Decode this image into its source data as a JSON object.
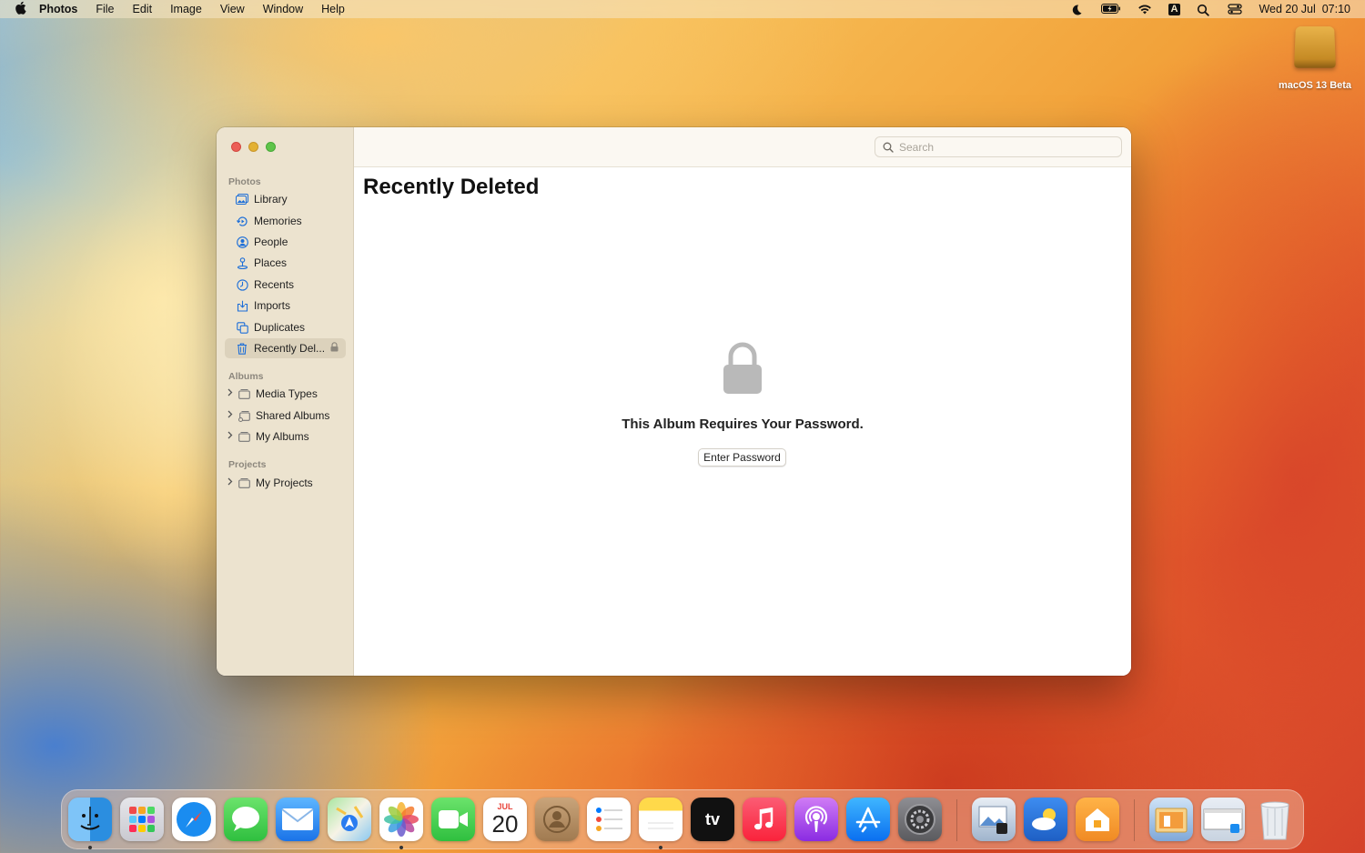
{
  "menubar": {
    "app_name": "Photos",
    "menus": [
      "File",
      "Edit",
      "Image",
      "View",
      "Window",
      "Help"
    ],
    "input_source": "A",
    "datetime": "Wed 20 Jul  07:10"
  },
  "desktop": {
    "disk_label": "macOS 13 Beta"
  },
  "sidebar": {
    "sections": {
      "photos": "Photos",
      "albums": "Albums",
      "projects": "Projects"
    },
    "items": [
      {
        "label": "Library",
        "icon": "library-icon"
      },
      {
        "label": "Memories",
        "icon": "memories-icon"
      },
      {
        "label": "People",
        "icon": "people-icon"
      },
      {
        "label": "Places",
        "icon": "places-icon"
      },
      {
        "label": "Recents",
        "icon": "recents-icon"
      },
      {
        "label": "Imports",
        "icon": "imports-icon"
      },
      {
        "label": "Duplicates",
        "icon": "duplicates-icon"
      },
      {
        "label": "Recently Del...",
        "icon": "trash-icon",
        "selected": true,
        "locked": true
      }
    ],
    "album_groups": [
      {
        "label": "Media Types"
      },
      {
        "label": "Shared Albums"
      },
      {
        "label": "My Albums"
      }
    ],
    "project_groups": [
      {
        "label": "My Projects"
      }
    ]
  },
  "main": {
    "search_placeholder": "Search",
    "title": "Recently Deleted",
    "lock_message": "This Album Requires Your Password.",
    "enter_password_label": "Enter Password"
  },
  "dock": {
    "calendar_month": "JUL",
    "calendar_day": "20",
    "apps": [
      "Finder",
      "Launchpad",
      "Safari",
      "Messages",
      "Mail",
      "Maps",
      "Photos",
      "FaceTime",
      "Calendar",
      "Contacts",
      "Reminders",
      "Notes",
      "TV",
      "Music",
      "Podcasts",
      "App Store",
      "System Settings",
      "Preview",
      "Weather",
      "Home",
      "Downloads",
      "Screen Capture",
      "Trash"
    ]
  },
  "colors": {
    "accent": "#1c6ed8",
    "sidebar_bg": "#ece3cf",
    "selected_bg": "#dcd2bc"
  }
}
